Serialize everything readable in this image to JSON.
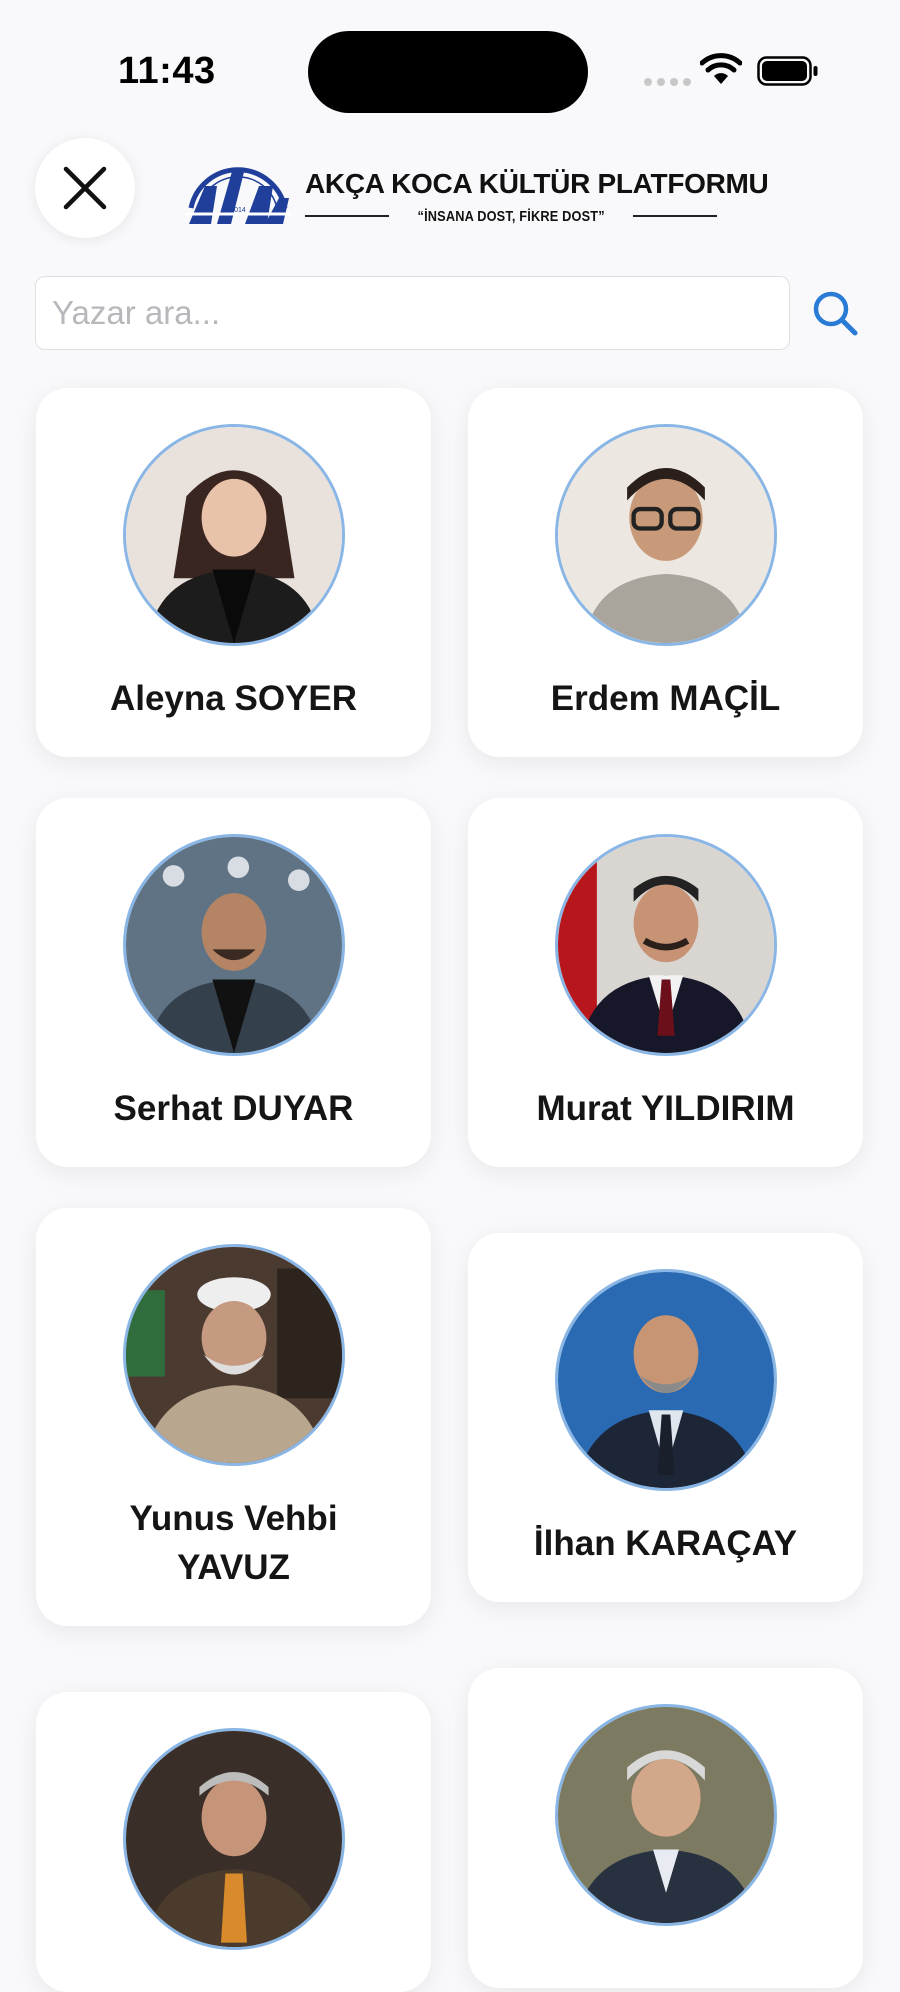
{
  "status_bar": {
    "time": "11:43"
  },
  "header": {
    "brand_title": "AKÇA KOCA KÜLTÜR PLATFORMU",
    "slogan": "“İNSANA DOST, FİKRE DOST”",
    "logo_year": "2014"
  },
  "search": {
    "placeholder": "Yazar ara..."
  },
  "authors": [
    {
      "name": "Aleyna SOYER"
    },
    {
      "name": "Erdem MAÇİL"
    },
    {
      "name": "Serhat DUYAR"
    },
    {
      "name": "Murat YILDIRIM"
    },
    {
      "name": "Yunus Vehbi YAVUZ"
    },
    {
      "name": "İlhan KARAÇAY"
    },
    {
      "name": ""
    },
    {
      "name": ""
    }
  ],
  "colors": {
    "accent": "#2a7bd6",
    "avatar_border": "#8ab6e6",
    "logo_blue": "#1f3f9b"
  }
}
